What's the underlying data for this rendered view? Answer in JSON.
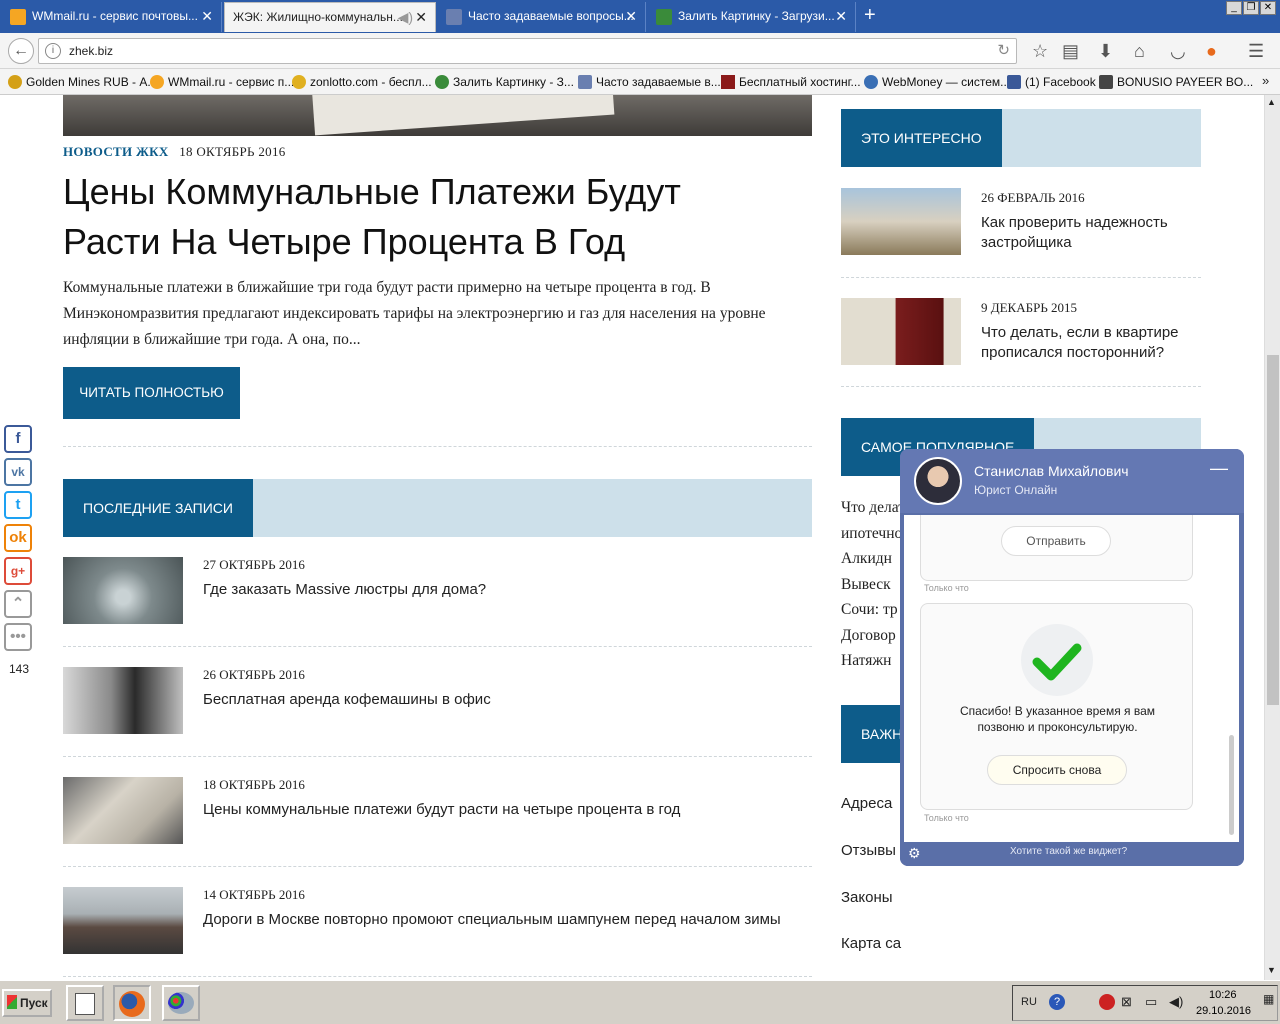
{
  "browser": {
    "tabs": [
      {
        "label": "WMmail.ru - сервис почтовы...",
        "icon": "wmmail-icon",
        "color": "#f5a623"
      },
      {
        "label": "ЖЭК: Жилищно-коммунальн...",
        "icon": "speaker-icon",
        "color": "#999999"
      },
      {
        "label": "Часто задаваемые вопросы...",
        "icon": "page-icon",
        "color": "#6a7fb0"
      },
      {
        "label": "Залить Картинку - Загрузи...",
        "icon": "image-icon",
        "color": "#3a8b3a"
      }
    ],
    "new_tab": "+",
    "url": "zhek.biz",
    "bookmarks": [
      {
        "label": "Golden Mines RUB - А..."
      },
      {
        "label": "WMmail.ru - сервис п..."
      },
      {
        "label": "zonlotto.com - беспл..."
      },
      {
        "label": "Залить Картинку - З..."
      },
      {
        "label": "Часто задаваемые в..."
      },
      {
        "label": "Бесплатный хостинг..."
      },
      {
        "label": "WebMoney — систем..."
      },
      {
        "label": "(1) Facebook"
      },
      {
        "label": "BONUSIO PAYEER BO..."
      }
    ],
    "bookmarks_more": "»"
  },
  "article": {
    "category": "НОВОСТИ ЖКХ",
    "date": "18 ОКТЯБРЬ 2016",
    "title": "Цены Коммунальные Платежи Будут Расти На Четыре Процента В Год",
    "excerpt": "Коммунальные платежи в ближайшие три года будут расти примерно на четыре процента в год. В Минэкономразвития предлагают индексировать тарифы на электроэнергию и газ для населения на уровне инфляции в ближайшие три года. А она, по...",
    "read_more": "ЧИТАТЬ ПОЛНОСТЬЮ"
  },
  "recent": {
    "heading": "ПОСЛЕДНИЕ ЗАПИСИ",
    "posts": [
      {
        "date": "27 ОКТЯБРЬ 2016",
        "title": "Где заказать Massive люстры для дома?"
      },
      {
        "date": "26 ОКТЯБРЬ 2016",
        "title": "Бесплатная аренда кофемашины в офис"
      },
      {
        "date": "18 ОКТЯБРЬ 2016",
        "title": "Цены коммунальные платежи будут расти на четыре процента в год"
      },
      {
        "date": "14 ОКТЯБРЬ 2016",
        "title": "Дороги в Москве повторно промоют специальным шампунем перед началом зимы"
      }
    ]
  },
  "sidebar": {
    "interesting_heading": "ЭТО ИНТЕРЕСНО",
    "interesting": [
      {
        "date": "26 ФЕВРАЛЬ 2016",
        "title": "Как проверить надежность застройщика"
      },
      {
        "date": "9 ДЕКАБРЬ 2015",
        "title": "Что делать, если в квартире прописался посторонний?"
      }
    ],
    "popular_heading": "САМОЕ ПОПУЛЯРНОЕ",
    "popular": [
      "Что делать при необходимости продажи ипотечной квартиры",
      "Алкидн",
      "Вывеск",
      "Сочи: тр",
      "Договор",
      "Натяжн"
    ],
    "important_heading": "ВАЖН",
    "links": [
      "Адреса",
      "Отзывы",
      "Законы",
      "Карта са"
    ]
  },
  "social": {
    "count": "143"
  },
  "chat": {
    "name": "Станислав Михайлович",
    "role": "Юрист Онлайн",
    "send_label": "Отправить",
    "timestamp": "Только что",
    "thanks": "Спасибо! В указанное время я вам позвоню и проконсультирую.",
    "ask_again": "Спросить снова",
    "footer": "Хотите такой же виджет?"
  },
  "taskbar": {
    "start": "Пуск",
    "lang": "RU",
    "time": "10:26",
    "date": "29.10.2016"
  },
  "colors": {
    "brand": "#0d5c8a",
    "section_bg": "#cde0ea",
    "chat": "#5a6fa8"
  }
}
